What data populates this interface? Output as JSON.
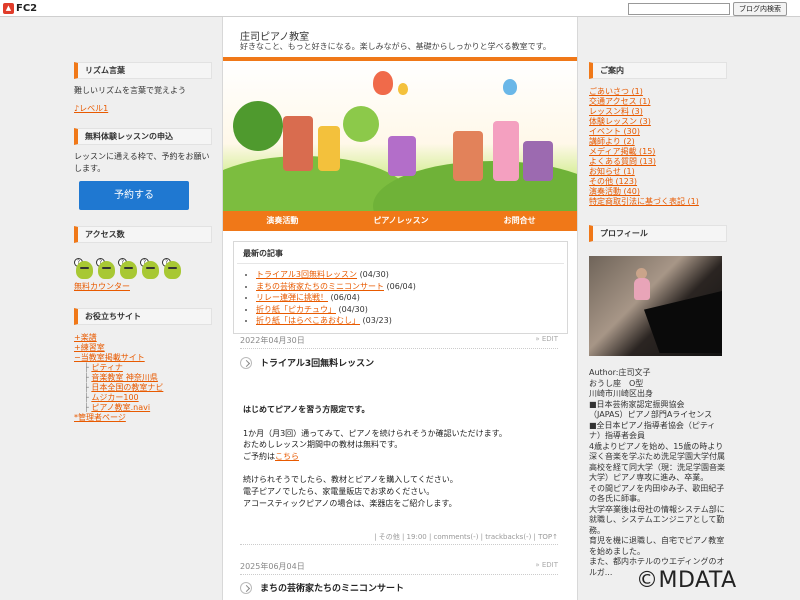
{
  "fc2": {
    "logo_text": "FC2",
    "search_placeholder": "",
    "search_button": "ブログ内検索"
  },
  "header": {
    "title": "庄司ピアノ教室",
    "description": "好きなこと、もっと好きになる。楽しみながら、基礎からしっかりと学べる教室です。"
  },
  "nav": {
    "items": [
      "演奏活動",
      "ピアノレッスン",
      "お問合せ"
    ]
  },
  "left": {
    "rhythm": {
      "title": "リズム言葉",
      "text": "難しいリズムを言葉で覚えよう",
      "link": "♪レベル1"
    },
    "trial": {
      "title": "無料体験レッスンの申込",
      "text": "レッスンに通える枠で、予約をお願いします。",
      "button": "予約する"
    },
    "access": {
      "title": "アクセス数",
      "link": "無料カウンター"
    },
    "sites": {
      "title": "お役立ちサイト",
      "items": [
        "+楽譜",
        "+練習室",
        "−当教室掲載サイト"
      ],
      "subitems": [
        "ピティナ",
        "音楽教室 神奈川県",
        "日本全国の教室ナビ",
        "ムジカー100",
        "ピアノ教室.navi"
      ],
      "admin": "*管理者ページ"
    }
  },
  "right": {
    "guide": {
      "title": "ご案内",
      "items": [
        "ごあいさつ (1)",
        "交通アクセス (1)",
        "レッスン料 (3)",
        "体験レッスン (3)",
        "イベント (30)",
        "講師より (2)",
        "メディア掲載 (15)",
        "よくある質問 (13)",
        "お知らせ (1)",
        "その他 (123)",
        "演奏活動 (40)",
        "特定商取引法に基づく表記 (1)"
      ]
    },
    "profile": {
      "title": "プロフィール",
      "lines": [
        "Author:庄司文子",
        "おうし座　O型",
        "川崎市川崎区出身",
        "■日本芸術家認定振興協会",
        "（JAPAS）ピアノ部門Aライセンス",
        "■全日本ピアノ指導者協会（ピティナ）指導者会員",
        "4歳よりピアノを始め、15歳の時より深く音楽を学ぶため洗足学園大学付属高校を経て同大学（現：洗足学園音楽大学）ピアノ専攻に進み、卒業。",
        "その間ピアノを内田ゆみ子、歌田紀子の各氏に師事。",
        "大学卒業後は母社の情報システム部に就職し、システムエンジニアとして勤務。",
        "育児を機に退職し、自宅でピアノ教室を始めました。",
        "また、都内ホテルのウエディングのオルガ..."
      ]
    }
  },
  "recent": {
    "title": "最新の記事",
    "items": [
      {
        "title": "トライアル3回無料レッスン",
        "date": "(04/30)"
      },
      {
        "title": "まちの芸術家たちのミニコンサート",
        "date": "(06/04)"
      },
      {
        "title": "リレー連弾に挑戦！",
        "date": "(06/04)"
      },
      {
        "title": "折り紙「ピカチュウ」",
        "date": "(04/30)"
      },
      {
        "title": "折り紙「はらぺこあおむし」",
        "date": "(03/23)"
      }
    ]
  },
  "entry1": {
    "date": "2022年04月30日",
    "edit": "» EDIT",
    "title": "トライアル3回無料レッスン",
    "lead": "はじめてピアノを習う方限定です。",
    "p1": [
      "1か月（月3回）通ってみて、ピアノを続けられそうか確認いただけます。",
      "おためしレッスン期間中の教材は無料です。"
    ],
    "p1_prefix": "ご予約は",
    "p1_link": "こちら",
    "p2": [
      "続けられそうでしたら、教材とピアノを購入してください。",
      "電子ピアノでしたら、家電量販店でお求めください。",
      "アコースティックピアノの場合は、楽器店をご紹介します。"
    ],
    "footer": "| その他 | 19:00 | comments(-) | trackbacks(-) | TOP↑"
  },
  "entry2": {
    "date": "2025年06月04日",
    "edit": "» EDIT",
    "title": "まちの芸術家たちのミニコンサート"
  },
  "watermark": "©MDATA"
}
